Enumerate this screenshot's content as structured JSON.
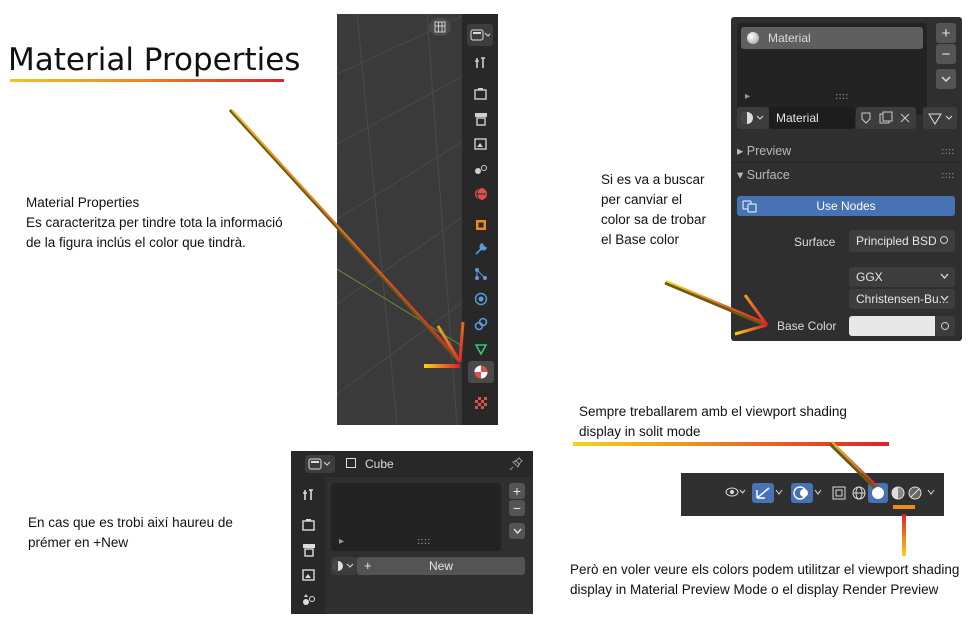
{
  "title": "Material Properties",
  "notes": {
    "main_heading": "Material Properties",
    "main_text": "Es caracteritza per tindre tota la informació de la figura inclús el color que tindrà.",
    "base_color_hint": "Si es va a buscar per canviar el color sa de trobar el Base color",
    "new_hint": "En cas que es trobi així haureu de prémer en +New",
    "viewport_hint": "Sempre treballarem amb el viewport shading display in solit mode",
    "preview_hint": "Però en voler veure els colors podem utilitzar el viewport shading display in Material Preview Mode o el display Render Preview"
  },
  "properties_tabs": [
    {
      "icon": "tool-icon",
      "color": "#cfcfcf"
    },
    {
      "icon": "render-icon",
      "color": "#cfcfcf"
    },
    {
      "icon": "output-icon",
      "color": "#cfcfcf"
    },
    {
      "icon": "view-layer-icon",
      "color": "#cfcfcf"
    },
    {
      "icon": "scene-icon",
      "color": "#cfcfcf"
    },
    {
      "icon": "world-icon",
      "color": "#e0504a"
    },
    {
      "icon": "object-icon",
      "color": "#f08a1e"
    },
    {
      "icon": "modifier-icon",
      "color": "#5a9ae0"
    },
    {
      "icon": "particles-icon",
      "color": "#5a9ae0"
    },
    {
      "icon": "physics-icon",
      "color": "#5a9ae0"
    },
    {
      "icon": "constraints-icon",
      "color": "#5a9ae0"
    },
    {
      "icon": "data-icon",
      "color": "#3ec27a"
    },
    {
      "icon": "material-icon",
      "color": "#e0504a"
    },
    {
      "icon": "texture-icon",
      "color": "#e0504a"
    }
  ],
  "material_panel": {
    "slot_name": "Material",
    "material_name": "Material",
    "plus": "+",
    "minus": "−",
    "preview_section": "Preview",
    "surface_section": "Surface",
    "use_nodes": "Use Nodes",
    "surface_label": "Surface",
    "surface_value": "Principled BSD",
    "distribution": "GGX",
    "subsurface": "Christensen-Bu...",
    "base_color_label": "Base Color",
    "base_color_value": "#e8e8e8"
  },
  "cube_panel": {
    "object_name": "Cube",
    "plus": "+",
    "minus": "−",
    "new_label": "New",
    "new_plus": "+"
  },
  "colors": {
    "accent_blue": "#4772b3",
    "arrow_yellow": "#f6d21b",
    "arrow_red": "#e0202a",
    "panel_bg": "#2f2f2f"
  }
}
